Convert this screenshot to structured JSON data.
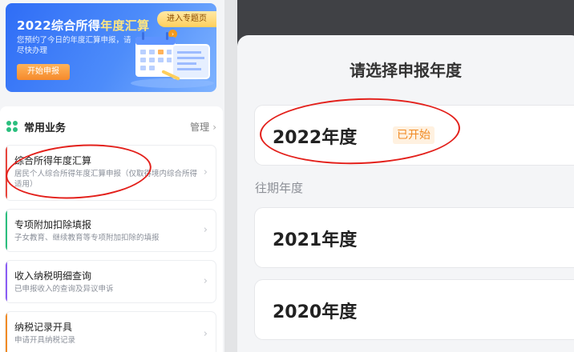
{
  "banner": {
    "title_prefix": "2022综合所得",
    "title_highlight": "年度汇算",
    "description": "您预约了今日的年度汇算申报，请尽快办理",
    "start_button": "开始申报",
    "topic_link": "进入专题页",
    "topic_link_icon": "›"
  },
  "common": {
    "title": "常用业务",
    "manage": "管理",
    "manage_arrow": "›",
    "items": [
      {
        "title": "综合所得年度汇算",
        "desc": "居民个人综合所得年度汇算申报（仅取得境内综合所得适用）",
        "accent": "#e8453c"
      },
      {
        "title": "专项附加扣除填报",
        "desc": "子女教育、继续教育等专项附加扣除的填报",
        "accent": "#2bbf7e"
      },
      {
        "title": "收入纳税明细查询",
        "desc": "已申报收入的查询及异议申诉",
        "accent": "#8a5cf5"
      },
      {
        "title": "纳税记录开具",
        "desc": "申请开具纳税记录",
        "accent": "#f08a24"
      }
    ],
    "item_arrow": "›"
  },
  "year_sheet": {
    "title": "请选择申报年度",
    "current": {
      "label": "2022年度",
      "badge": "已开始"
    },
    "past_heading": "往期年度",
    "past": [
      {
        "label": "2021年度"
      },
      {
        "label": "2020年度"
      }
    ]
  },
  "colors": {
    "brand_blue": "#2f6df6",
    "annotation_red": "#e3201b",
    "badge_orange": "#f08a24"
  }
}
